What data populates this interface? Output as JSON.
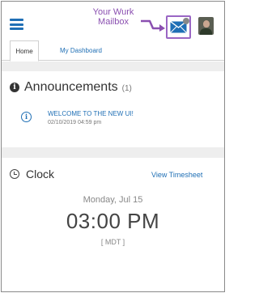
{
  "header": {
    "callout_text": "Your Wurk Mailbox",
    "menu_icon": "hamburger-icon",
    "mailbox_icon": "envelope-icon",
    "avatar_icon": "user-avatar",
    "accent_color": "#1f6fb5",
    "callout_color": "#8a4fb0"
  },
  "tabs": [
    {
      "label": "Home",
      "active": true
    },
    {
      "label": "My Dashboard",
      "active": false
    }
  ],
  "announcements": {
    "title": "Announcements",
    "count": "(1)",
    "items": [
      {
        "title": "WELCOME TO THE NEW UI!",
        "date": "02/10/2019 04:59 pm"
      }
    ]
  },
  "clock": {
    "title": "Clock",
    "timesheet_link": "View Timesheet",
    "date": "Monday, Jul 15",
    "time": "03:00 PM",
    "timezone": "[ MDT ]"
  }
}
